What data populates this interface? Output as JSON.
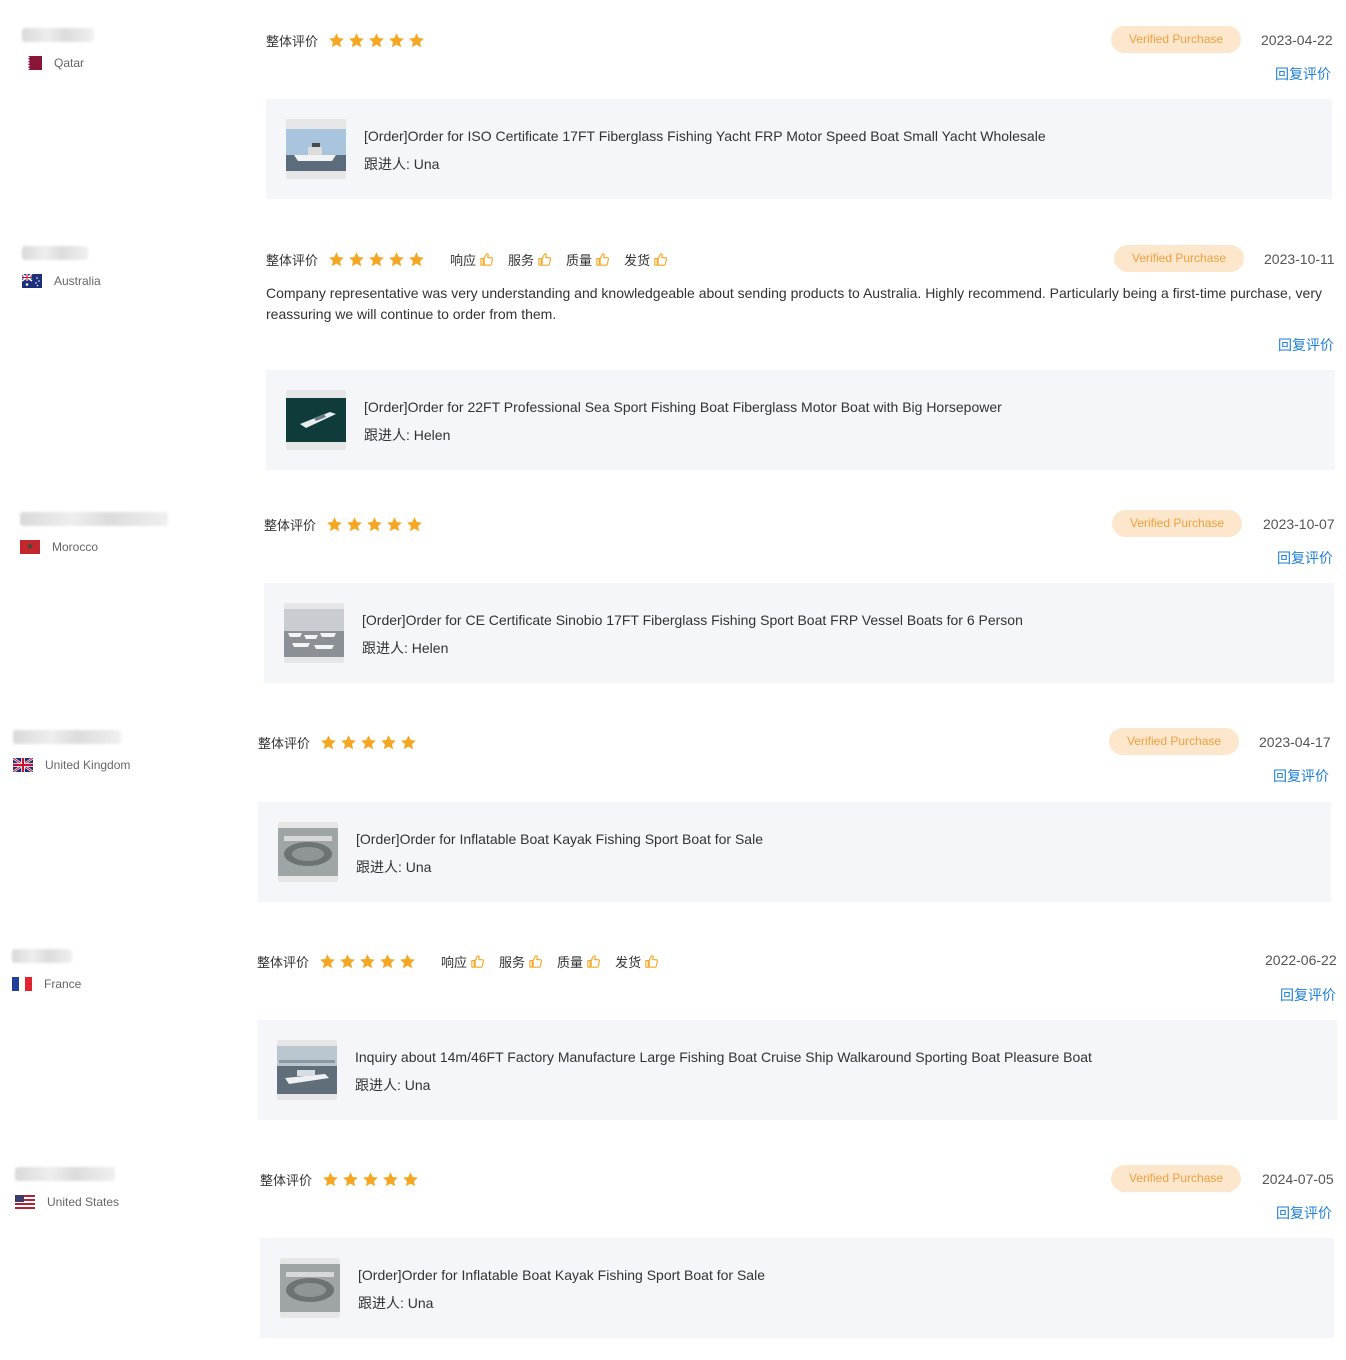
{
  "labels": {
    "overall_rating": "整体评价",
    "verified_purchase": "Verified Purchase",
    "reply": "回复评价",
    "follower_prefix": "跟进人:"
  },
  "sub_ratings": [
    "响应",
    "服务",
    "质量",
    "发货"
  ],
  "colors": {
    "star": "#f5a623",
    "reply_link": "#1e7fd6",
    "verified_bg": "#fde7cc",
    "verified_text": "#f0a040",
    "card_bg": "#f5f6fa"
  },
  "reviews": [
    {
      "country": "Qatar",
      "flag_icon": "qatar-flag-icon",
      "stars": 5,
      "verified": true,
      "date": "2023-04-22",
      "comment": "",
      "product": "[Order]Order for ISO Certificate 17FT Fiberglass Fishing Yacht FRP Motor Speed Boat Small Yacht Wholesale",
      "follower": "Una"
    },
    {
      "country": "Australia",
      "flag_icon": "australia-flag-icon",
      "stars": 5,
      "verified": true,
      "date": "2023-10-11",
      "comment": "Company representative was very understanding and knowledgeable about sending products to Australia. Highly recommend. Particularly being a first-time purchase, very reassuring we will continue to order from them.",
      "product": "[Order]Order for 22FT Professional Sea Sport Fishing Boat Fiberglass Motor Boat with Big Horsepower",
      "follower": "Helen"
    },
    {
      "country": "Morocco",
      "flag_icon": "morocco-flag-icon",
      "stars": 5,
      "verified": true,
      "date": "2023-10-07",
      "comment": "",
      "product": "[Order]Order for CE Certificate Sinobio 17FT Fiberglass Fishing Sport Boat FRP Vessel Boats for 6 Person",
      "follower": "Helen"
    },
    {
      "country": "United Kingdom",
      "flag_icon": "uk-flag-icon",
      "stars": 5,
      "verified": true,
      "date": "2023-04-17",
      "comment": "",
      "product": "[Order]Order for Inflatable Boat Kayak Fishing Sport Boat for Sale",
      "follower": "Una"
    },
    {
      "country": "France",
      "flag_icon": "france-flag-icon",
      "stars": 5,
      "verified": false,
      "date": "2022-06-22",
      "comment": "",
      "product": "Inquiry about 14m/46FT Factory Manufacture Large Fishing Boat Cruise Ship Walkaround Sporting Boat Pleasure Boat",
      "follower": "Una"
    },
    {
      "country": "United States",
      "flag_icon": "us-flag-icon",
      "stars": 5,
      "verified": true,
      "date": "2024-07-05",
      "comment": "",
      "product": "[Order]Order for Inflatable Boat Kayak Fishing Sport Boat for Sale",
      "follower": "Una"
    }
  ]
}
